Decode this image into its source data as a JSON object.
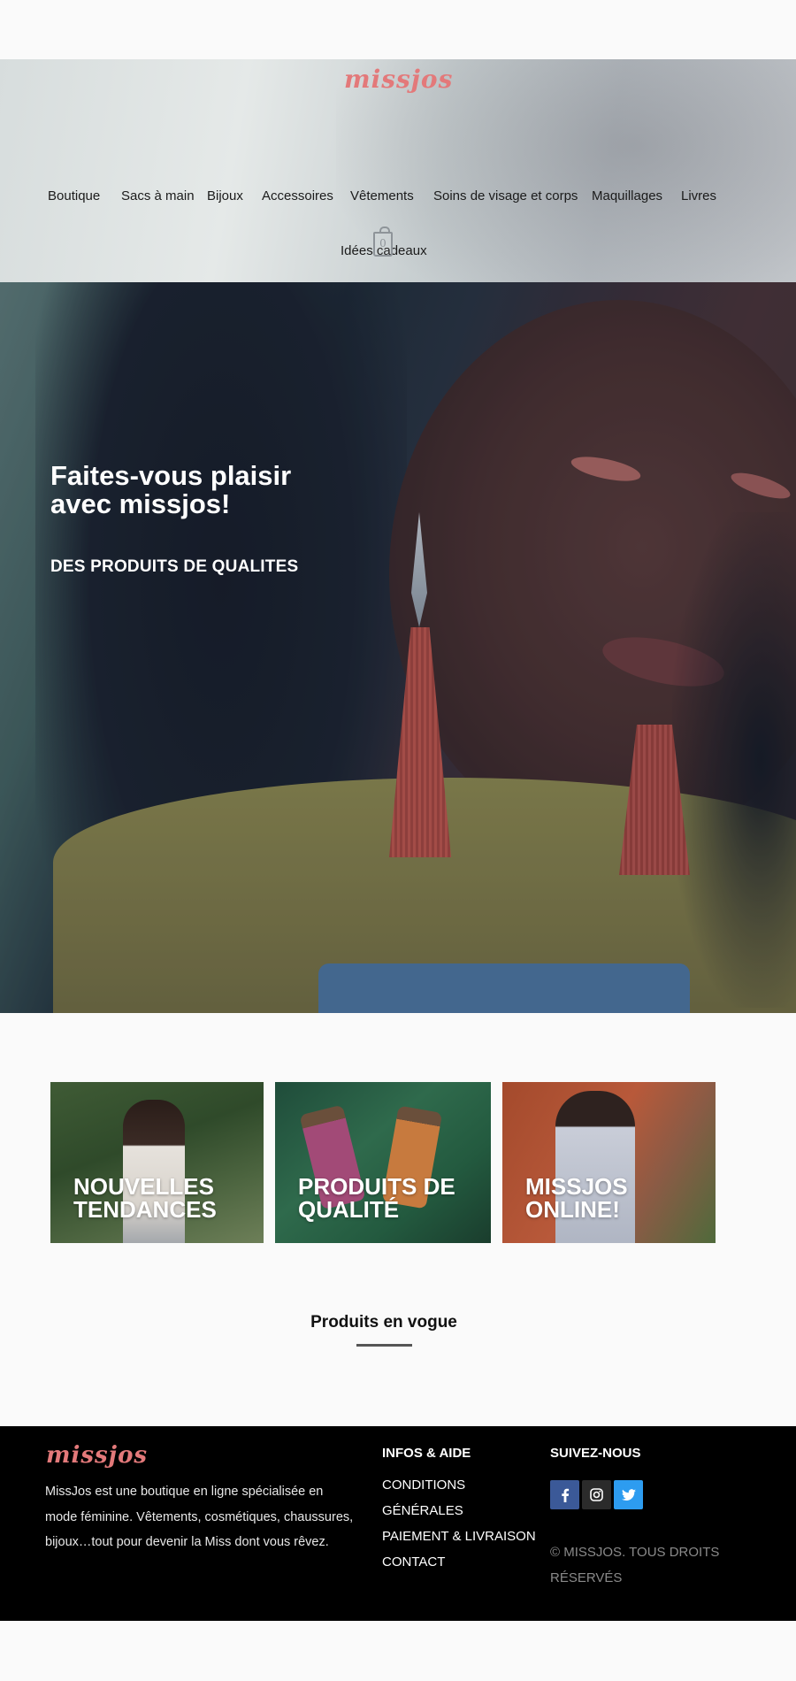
{
  "brand": {
    "logo_text": "missjos",
    "accent_color": "#e3797a"
  },
  "nav": {
    "items": [
      {
        "label": "Boutique"
      },
      {
        "label": "Sacs à main"
      },
      {
        "label": "Bijoux"
      },
      {
        "label": "Accessoires"
      },
      {
        "label": "Vêtements"
      },
      {
        "label": "Soins de visage et corps"
      },
      {
        "label": "Maquillages"
      },
      {
        "label": "Livres"
      },
      {
        "label": "Idées cadeaux"
      }
    ],
    "cart": {
      "icon": "shopping-bag-icon",
      "count": "0"
    }
  },
  "hero": {
    "title": "Faites-vous plaisir avec missjos!",
    "subtitle": "DES PRODUITS DE QUALITES"
  },
  "categories": [
    {
      "label": "NOUVELLES TENDANCES"
    },
    {
      "label": "PRODUITS DE QUALITÉ"
    },
    {
      "label": "MISSJOS ONLINE!"
    }
  ],
  "trending": {
    "title": "Produits en vogue"
  },
  "footer": {
    "logo_text": "missjos",
    "description": "MissJos est une boutique en ligne spécialisée en mode féminine. Vêtements, cosmétiques, chaussures, bijoux…tout pour devenir la Miss dont vous rêvez.",
    "info_heading": "INFOS & AIDE",
    "info_links": [
      {
        "label": "CONDITIONS"
      },
      {
        "label": "GÉNÉRALES"
      },
      {
        "label": "PAIEMENT & LIVRAISON"
      },
      {
        "label": "CONTACT"
      }
    ],
    "social_heading": "SUIVEZ-NOUS",
    "social": [
      {
        "name": "facebook",
        "icon": "facebook-icon",
        "color": "#3b5998"
      },
      {
        "name": "instagram",
        "icon": "instagram-icon",
        "color": "#2b2b2b"
      },
      {
        "name": "twitter",
        "icon": "twitter-icon",
        "color": "#2d9cf0"
      }
    ],
    "copyright": "© MISSJOS. TOUS DROITS RÉSERVÉS"
  }
}
